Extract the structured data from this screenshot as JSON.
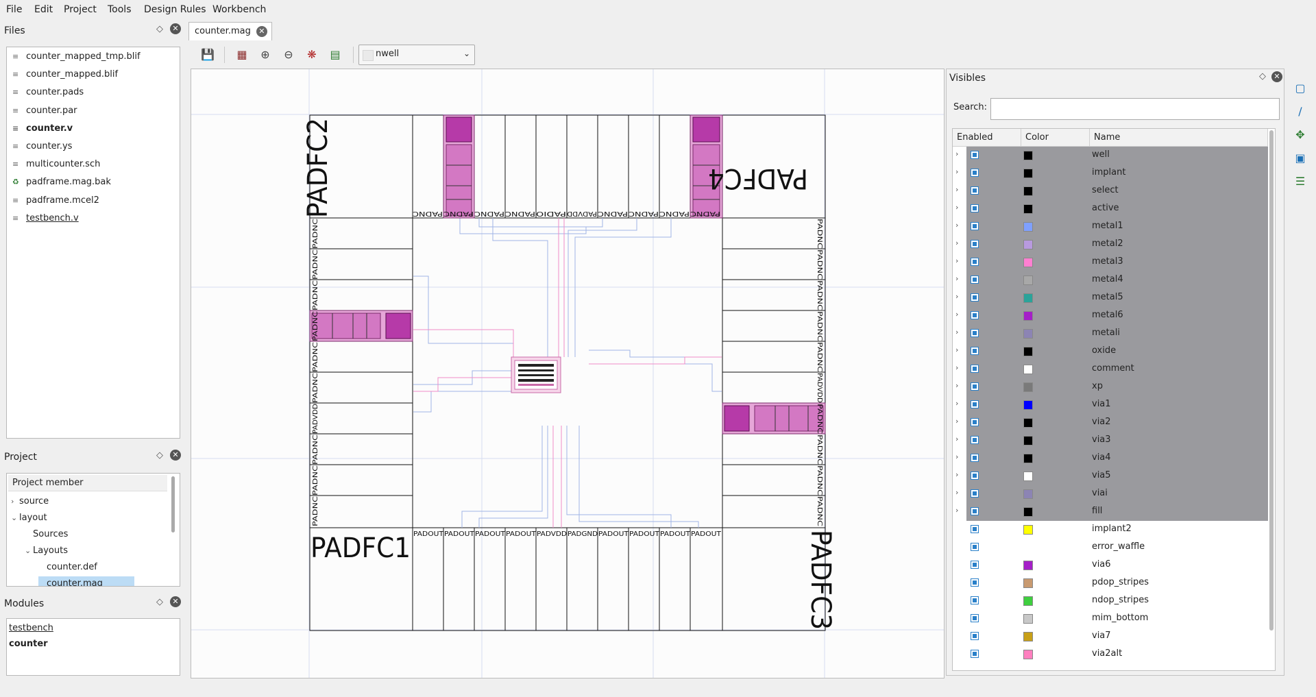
{
  "menubar": [
    "File",
    "Edit",
    "Project",
    "Tools",
    "Design Rules",
    "Workbench"
  ],
  "files_panel": {
    "title": "Files",
    "items": [
      {
        "label": "counter_mapped_tmp.blif",
        "icon": "text-file-icon",
        "style": ""
      },
      {
        "label": "counter_mapped.blif",
        "icon": "text-file-icon",
        "style": ""
      },
      {
        "label": "counter.pads",
        "icon": "text-file-icon",
        "style": ""
      },
      {
        "label": "counter.par",
        "icon": "text-file-icon",
        "style": ""
      },
      {
        "label": "counter.v",
        "icon": "text-file-icon",
        "style": "bold"
      },
      {
        "label": "counter.ys",
        "icon": "text-file-icon",
        "style": ""
      },
      {
        "label": "multicounter.sch",
        "icon": "text-file-icon",
        "style": ""
      },
      {
        "label": "padframe.mag.bak",
        "icon": "recycle-icon",
        "style": ""
      },
      {
        "label": "padframe.mcel2",
        "icon": "text-file-icon",
        "style": ""
      },
      {
        "label": "testbench.v",
        "icon": "text-file-icon",
        "style": "under"
      }
    ]
  },
  "project_panel": {
    "title": "Project",
    "header": "Project member",
    "tree": [
      {
        "label": "source",
        "level": 0,
        "arrow": "›"
      },
      {
        "label": "layout",
        "level": 0,
        "arrow": "⌄"
      },
      {
        "label": "Sources",
        "level": 1,
        "arrow": ""
      },
      {
        "label": "Layouts",
        "level": 1,
        "arrow": "⌄"
      },
      {
        "label": "counter.def",
        "level": 2,
        "arrow": ""
      },
      {
        "label": "counter.mag",
        "level": 2,
        "arrow": "",
        "selected": true
      }
    ]
  },
  "modules_panel": {
    "title": "Modules",
    "items": [
      {
        "label": "testbench",
        "style": "under"
      },
      {
        "label": "counter",
        "style": "bold"
      }
    ]
  },
  "editor": {
    "tab_label": "counter.mag",
    "layer_select": "nwell"
  },
  "layout_labels": {
    "pad_tl": "PADFC2",
    "pad_tr": "PADFC4",
    "pad_bl": "PADFC1",
    "pad_br": "PADFC3",
    "padout": "PADOUT",
    "padnc": "PADNC",
    "padvdd": "PADVDD",
    "padgnd": "PADGND",
    "padio": "PADIO"
  },
  "visibles": {
    "title": "Visibles",
    "search_label": "Search:",
    "search_value": "",
    "columns": [
      "Enabled",
      "Color",
      "Name"
    ],
    "layers": [
      {
        "name": "well",
        "color": "#000000",
        "group": true
      },
      {
        "name": "implant",
        "color": "#000000",
        "group": true
      },
      {
        "name": "select",
        "color": "#000000",
        "group": true
      },
      {
        "name": "active",
        "color": "#000000",
        "group": true
      },
      {
        "name": "metal1",
        "color": "#7fa0ff",
        "group": true
      },
      {
        "name": "metal2",
        "color": "#b89adf",
        "group": true
      },
      {
        "name": "metal3",
        "color": "#ff7fd2",
        "group": true
      },
      {
        "name": "metal4",
        "color": "#a8a8a8",
        "group": true
      },
      {
        "name": "metal5",
        "color": "#2ba39a",
        "group": true
      },
      {
        "name": "metal6",
        "color": "#a51fc8",
        "group": true
      },
      {
        "name": "metali",
        "color": "#8c84b4",
        "group": true
      },
      {
        "name": "oxide",
        "color": "#000000",
        "group": true
      },
      {
        "name": "comment",
        "color": "#ffffff",
        "group": true
      },
      {
        "name": "xp",
        "color": "#7a7a7a",
        "group": true
      },
      {
        "name": "via1",
        "color": "#0000ff",
        "group": true
      },
      {
        "name": "via2",
        "color": "#000000",
        "group": true
      },
      {
        "name": "via3",
        "color": "#000000",
        "group": true
      },
      {
        "name": "via4",
        "color": "#000000",
        "group": true
      },
      {
        "name": "via5",
        "color": "#ffffff",
        "group": true
      },
      {
        "name": "viai",
        "color": "#8c84b4",
        "group": true
      },
      {
        "name": "fill",
        "color": "#000000",
        "group": true
      },
      {
        "name": "implant2",
        "color": "#ffff00",
        "group": false
      },
      {
        "name": "error_waffle",
        "color": "",
        "group": false
      },
      {
        "name": "via6",
        "color": "#a51fc8",
        "group": false
      },
      {
        "name": "pdop_stripes",
        "color": "#c89a70",
        "group": false
      },
      {
        "name": "ndop_stripes",
        "color": "#3fcf3f",
        "group": false
      },
      {
        "name": "mim_bottom",
        "color": "#c8c8c8",
        "group": false
      },
      {
        "name": "via7",
        "color": "#c8a018",
        "group": false
      },
      {
        "name": "via2alt",
        "color": "#ff7fbf",
        "group": false
      }
    ]
  }
}
